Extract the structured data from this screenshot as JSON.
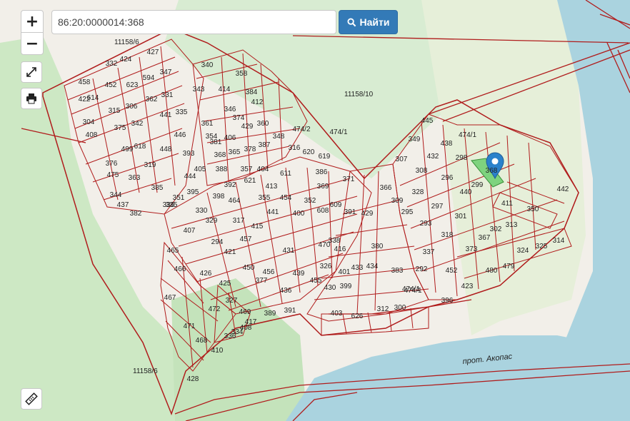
{
  "search": {
    "value": "86:20:0000014:368",
    "button_label": "Найти"
  },
  "controls": {
    "zoom_in": "+",
    "zoom_out": "−"
  },
  "map": {
    "colors": {
      "land": "#f2efe9",
      "water": "#aad3df",
      "forest": "#cde8c4",
      "parcel_border": "#b01c1c",
      "selected_parcel": "#7ed37e",
      "marker": "#2a81cb"
    },
    "river_label": "прот. Акопас",
    "area_labels": [
      "11158/10",
      "11158/6",
      "11158/6",
      "474/1",
      "474/1"
    ],
    "parcel_numbers": [
      "458",
      "332",
      "424",
      "427",
      "422",
      "452",
      "623",
      "594",
      "347",
      "340",
      "358",
      "414",
      "384",
      "343",
      "315",
      "306",
      "362",
      "331",
      "335",
      "346",
      "374",
      "412",
      "304",
      "375",
      "342",
      "441",
      "446",
      "361",
      "381",
      "406",
      "429",
      "360",
      "408",
      "614",
      "499",
      "618",
      "319",
      "448",
      "393",
      "354",
      "368",
      "365",
      "378",
      "387",
      "348",
      "316",
      "474/2",
      "620",
      "619",
      "376",
      "475",
      "363",
      "385",
      "444",
      "405",
      "388",
      "357",
      "404",
      "611",
      "386",
      "344",
      "437",
      "335",
      "351",
      "395",
      "398",
      "392",
      "621",
      "413",
      "454",
      "369",
      "371",
      "382",
      "336",
      "330",
      "329",
      "464",
      "355",
      "441",
      "352",
      "400",
      "608",
      "609",
      "391",
      "407",
      "294",
      "317",
      "415",
      "429",
      "338",
      "421",
      "457",
      "431",
      "470",
      "416",
      "380",
      "465",
      "450",
      "456",
      "377",
      "439",
      "326",
      "401",
      "433",
      "434",
      "436",
      "455",
      "430",
      "399",
      "466",
      "426",
      "425",
      "327",
      "467",
      "472",
      "469",
      "389",
      "391",
      "471",
      "408",
      "334",
      "417",
      "468",
      "336",
      "410",
      "428",
      "403",
      "626",
      "312",
      "300",
      "396",
      "423",
      "307",
      "349",
      "445",
      "432",
      "438",
      "298",
      "474/1",
      "308",
      "296",
      "299",
      "440",
      "411",
      "350",
      "442",
      "366",
      "309",
      "328",
      "297",
      "295",
      "293",
      "301",
      "318",
      "313",
      "302",
      "373",
      "367",
      "314",
      "325",
      "337",
      "324",
      "292",
      "383",
      "452",
      "480",
      "479",
      "474/1",
      "368"
    ]
  }
}
